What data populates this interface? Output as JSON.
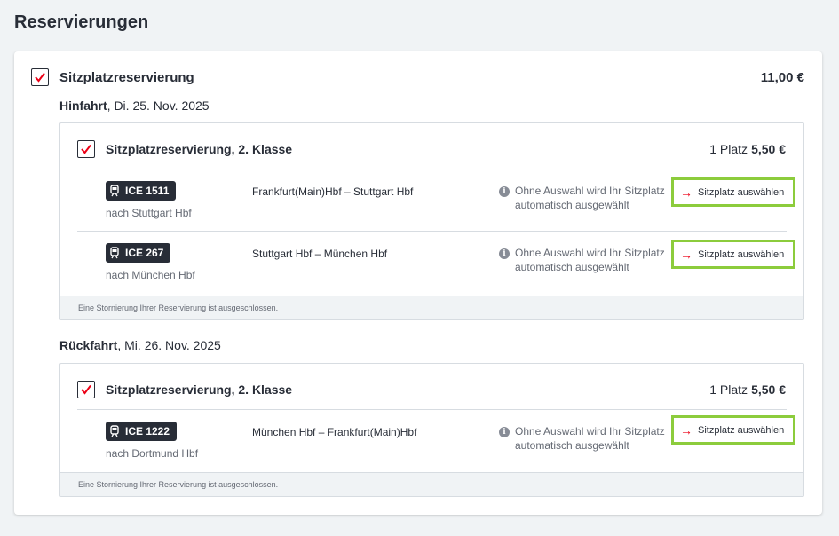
{
  "page_title": "Reservierungen",
  "main": {
    "label": "Sitzplatzreservierung",
    "price": "11,00 €",
    "checked": true
  },
  "outbound": {
    "direction": "Hinfahrt",
    "date": ", Di. 25. Nov. 2025",
    "reservation_label": "Sitzplatzreservierung, 2. Klasse",
    "places": "1 Platz",
    "price": "5,50 €",
    "legs": [
      {
        "train": "ICE 1511",
        "destination": "nach Stuttgart Hbf",
        "route": "Frankfurt(Main)Hbf  –  Stuttgart Hbf",
        "info": "Ohne Auswahl wird Ihr Sitzplatz automatisch ausgewählt",
        "button": "Sitzplatz auswählen"
      },
      {
        "train": "ICE 267",
        "destination": "nach München Hbf",
        "route": "Stuttgart Hbf  –  München Hbf",
        "info": "Ohne Auswahl wird Ihr Sitzplatz automatisch ausgewählt",
        "button": "Sitzplatz auswählen"
      }
    ],
    "footnote": "Eine Stornierung Ihrer Reservierung ist ausgeschlossen."
  },
  "return": {
    "direction": "Rückfahrt",
    "date": ", Mi. 26. Nov. 2025",
    "reservation_label": "Sitzplatzreservierung, 2. Klasse",
    "places": "1 Platz",
    "price": "5,50 €",
    "legs": [
      {
        "train": "ICE 1222",
        "destination": "nach Dortmund Hbf",
        "route": "München Hbf  –  Frankfurt(Main)Hbf",
        "info": "Ohne Auswahl wird Ihr Sitzplatz automatisch ausgewählt",
        "button": "Sitzplatz auswählen"
      }
    ],
    "footnote": "Eine Stornierung Ihrer Reservierung ist ausgeschlossen."
  },
  "colors": {
    "accent_red": "#ec0016",
    "highlight_green": "#8ccc3c",
    "text_dark": "#282d37",
    "text_muted": "#646973"
  },
  "icons": {
    "checkmark": "checkmark-icon",
    "train": "train-icon",
    "info": "info-icon",
    "arrow": "arrow-right-icon"
  }
}
